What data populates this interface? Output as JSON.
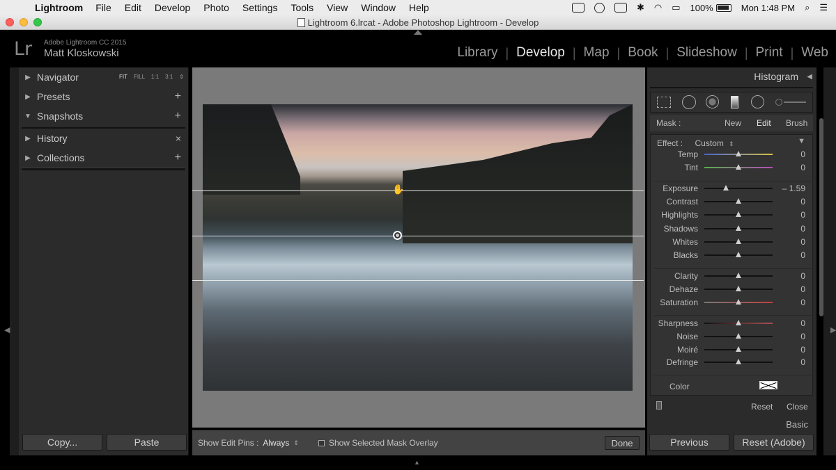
{
  "menubar": {
    "app": "Lightroom",
    "items": [
      "File",
      "Edit",
      "Develop",
      "Photo",
      "Settings",
      "Tools",
      "View",
      "Window",
      "Help"
    ],
    "battery": "100%",
    "clock": "Mon 1:48 PM"
  },
  "window": {
    "title": "Lightroom 6.lrcat - Adobe Photoshop Lightroom - Develop"
  },
  "identity": {
    "logo": "Lr",
    "product": "Adobe Lightroom CC 2015",
    "user": "Matt Kloskowski"
  },
  "modules": [
    "Library",
    "Develop",
    "Map",
    "Book",
    "Slideshow",
    "Print",
    "Web"
  ],
  "active_module": "Develop",
  "left_panel": {
    "navigator": "Navigator",
    "nav_options": [
      "FIT",
      "FILL",
      "1:1",
      "3:1"
    ],
    "presets": "Presets",
    "snapshots": "Snapshots",
    "history": "History",
    "collections": "Collections",
    "copy": "Copy...",
    "paste": "Paste"
  },
  "toolbar": {
    "show_edit_pins_label": "Show Edit Pins :",
    "show_edit_pins_value": "Always",
    "overlay_label": "Show Selected Mask Overlay",
    "done": "Done"
  },
  "right_panel": {
    "histogram": "Histogram",
    "mask_label": "Mask :",
    "mask_new": "New",
    "mask_edit": "Edit",
    "mask_brush": "Brush",
    "effect_label": "Effect :",
    "effect_value": "Custom",
    "sliders": [
      {
        "name": "Temp",
        "value": "0",
        "pos": 0.5
      },
      {
        "name": "Tint",
        "value": "0",
        "pos": 0.5
      },
      {
        "name": "Exposure",
        "value": "– 1.59",
        "pos": 0.32
      },
      {
        "name": "Contrast",
        "value": "0",
        "pos": 0.5
      },
      {
        "name": "Highlights",
        "value": "0",
        "pos": 0.5
      },
      {
        "name": "Shadows",
        "value": "0",
        "pos": 0.5
      },
      {
        "name": "Whites",
        "value": "0",
        "pos": 0.5
      },
      {
        "name": "Blacks",
        "value": "0",
        "pos": 0.5
      },
      {
        "name": "Clarity",
        "value": "0",
        "pos": 0.5
      },
      {
        "name": "Dehaze",
        "value": "0",
        "pos": 0.5
      },
      {
        "name": "Saturation",
        "value": "0",
        "pos": 0.5
      },
      {
        "name": "Sharpness",
        "value": "0",
        "pos": 0.5
      },
      {
        "name": "Noise",
        "value": "0",
        "pos": 0.5
      },
      {
        "name": "Moiré",
        "value": "0",
        "pos": 0.5
      },
      {
        "name": "Defringe",
        "value": "0",
        "pos": 0.5
      }
    ],
    "color_label": "Color",
    "reset": "Reset",
    "close": "Close",
    "basic": "Basic",
    "previous": "Previous",
    "reset_adobe": "Reset (Adobe)"
  },
  "colors": {
    "panel_bg": "#2b2b2b",
    "canvas_bg": "#7a7a7a",
    "active_module": "#e8e8e8"
  }
}
